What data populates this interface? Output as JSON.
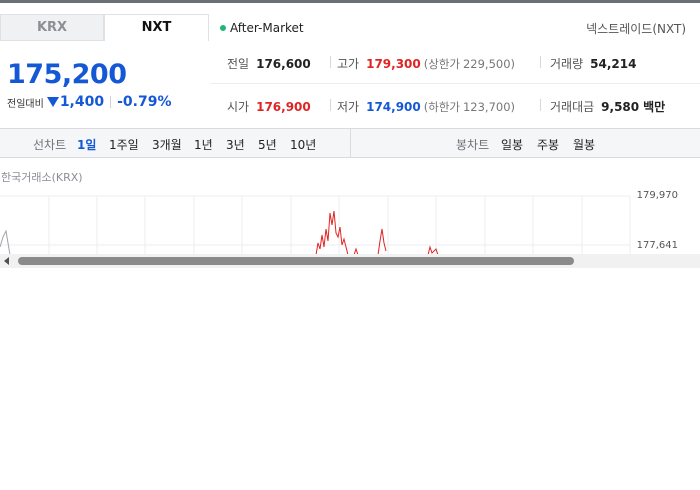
{
  "tabs": [
    {
      "label": "KRX",
      "active": false
    },
    {
      "label": "NXT",
      "active": true
    }
  ],
  "session": {
    "label": "After-Market",
    "indicator_color": "#22b573"
  },
  "exchange_name": "넥스트레이드(NXT)",
  "price": {
    "current": "175,200",
    "change_label": "전일대비",
    "change_amount": "1,400",
    "change_direction": "down",
    "change_percent": "-0.79%"
  },
  "stats": {
    "prev_close": {
      "label": "전일",
      "value": "176,600"
    },
    "high": {
      "label": "고가",
      "value": "179,300",
      "sub_label": "(상한가",
      "sub_value": "229,500)"
    },
    "volume": {
      "label": "거래량",
      "value": "54,214"
    },
    "open": {
      "label": "시가",
      "value": "176,900"
    },
    "low": {
      "label": "저가",
      "value": "174,900",
      "sub_label": "(하한가",
      "sub_value": "123,700)"
    },
    "amount": {
      "label": "거래대금",
      "value": "9,580",
      "unit": "백만"
    }
  },
  "period_bar": {
    "line_chart_label": "선차트",
    "line_periods": [
      "1일",
      "1주일",
      "3개월",
      "1년",
      "3년",
      "5년",
      "10년"
    ],
    "active_period": "1일",
    "candle_chart_label": "봉차트",
    "candle_periods": [
      "일봉",
      "주봉",
      "월봉"
    ]
  },
  "chart": {
    "source_label": "한국거래소(KRX)",
    "y_ticks": [
      "179,970",
      "177,641"
    ],
    "up_color": "#e02424"
  },
  "colors": {
    "up": "#e02424",
    "down": "#1558d6",
    "accent": "#1558d6"
  }
}
